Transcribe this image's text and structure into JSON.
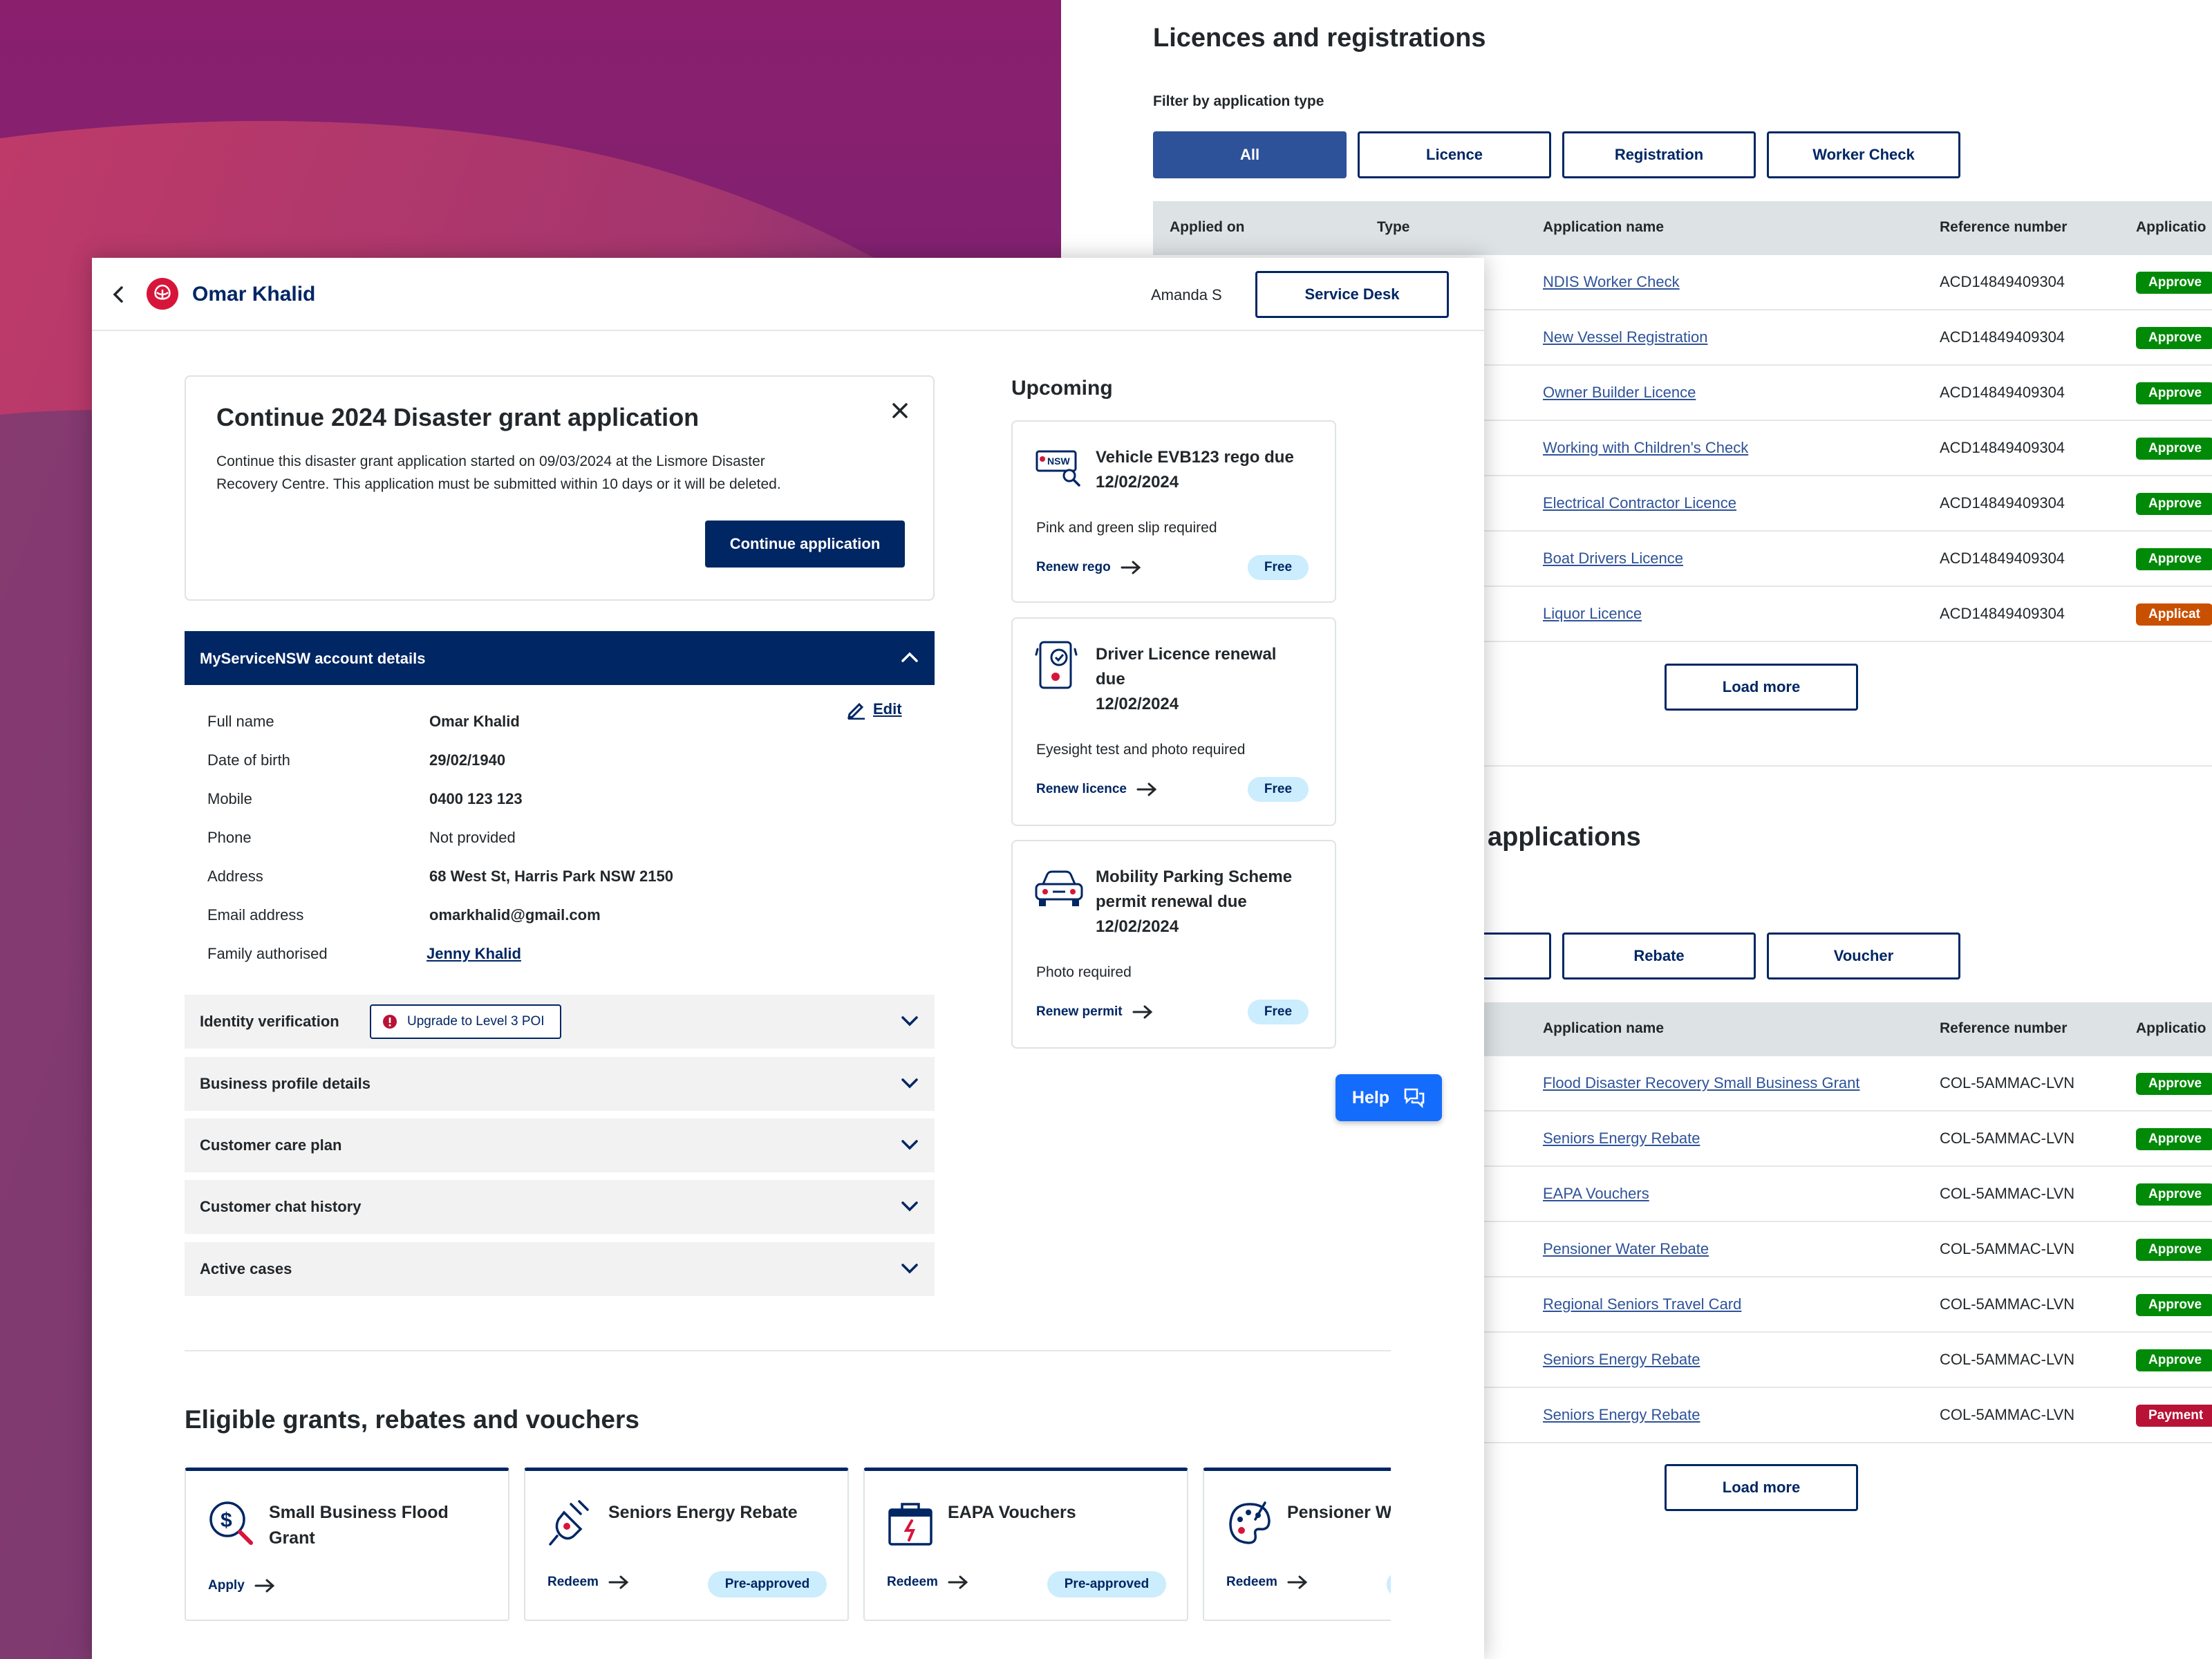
{
  "colors": {
    "navy": "#002664",
    "link": "#2e5299",
    "approved": "#008a07",
    "applicant": "#c95000",
    "payment": "#b81237",
    "help": "#146cfd",
    "badge_bg": "#cbedfd"
  },
  "licences": {
    "title": "Licences and registrations",
    "filter_label": "Filter by application type",
    "filters": [
      "All",
      "Licence",
      "Registration",
      "Worker Check"
    ],
    "columns": [
      "Applied on",
      "Type",
      "Application name",
      "Reference number",
      "Applicatio"
    ],
    "rows": [
      {
        "name": "NDIS Worker Check",
        "ref": "ACD14849409304",
        "status": "Approve",
        "tone": "green"
      },
      {
        "name": "New Vessel Registration",
        "ref": "ACD14849409304",
        "status": "Approve",
        "tone": "green"
      },
      {
        "name": "Owner Builder Licence",
        "ref": "ACD14849409304",
        "status": "Approve",
        "tone": "green"
      },
      {
        "name": "Working with Children's Check",
        "ref": "ACD14849409304",
        "status": "Approve",
        "tone": "green"
      },
      {
        "name": "Electrical Contractor Licence",
        "ref": "ACD14849409304",
        "status": "Approve",
        "tone": "green"
      },
      {
        "name": "Boat Drivers Licence",
        "ref": "ACD14849409304",
        "status": "Approve",
        "tone": "green"
      },
      {
        "name": "Liquor Licence",
        "ref": "ACD14849409304",
        "status": "Applicat",
        "tone": "orange"
      }
    ],
    "load_more": "Load more"
  },
  "applications": {
    "title": "applications",
    "filters": [
      "Rebate",
      "Voucher"
    ],
    "columns": [
      "Application name",
      "Reference number",
      "Applicatio"
    ],
    "rows": [
      {
        "name": "Flood Disaster Recovery Small Business Grant",
        "ref": "COL-5AMMAC-LVN",
        "status": "Approve",
        "tone": "green"
      },
      {
        "name": "Seniors Energy Rebate",
        "ref": "COL-5AMMAC-LVN",
        "status": "Approve",
        "tone": "green"
      },
      {
        "name": "EAPA Vouchers",
        "ref": "COL-5AMMAC-LVN",
        "status": "Approve",
        "tone": "green"
      },
      {
        "name": "Pensioner Water Rebate",
        "ref": "COL-5AMMAC-LVN",
        "status": "Approve",
        "tone": "green"
      },
      {
        "name": "Regional Seniors Travel Card",
        "ref": "COL-5AMMAC-LVN",
        "status": "Approve",
        "tone": "green"
      },
      {
        "name": "Seniors Energy Rebate",
        "ref": "COL-5AMMAC-LVN",
        "status": "Approve",
        "tone": "green"
      },
      {
        "name": "Seniors Energy Rebate",
        "ref": "COL-5AMMAC-LVN",
        "status": "Payment",
        "tone": "red"
      }
    ],
    "load_more": "Load more"
  },
  "header": {
    "customer_name": "Omar Khalid",
    "agent": "Amanda S",
    "service_desk": "Service Desk"
  },
  "continue_card": {
    "title": "Continue 2024 Disaster grant application",
    "body_line1": "Continue this disaster grant application started on 09/03/2024 at the Lismore Disaster",
    "body_line2": "Recovery Centre. This application must be submitted within 10 days or it will be deleted.",
    "button": "Continue application"
  },
  "account": {
    "title": "MyServiceNSW account details",
    "edit": "Edit",
    "fields": [
      {
        "label": "Full name",
        "value": "Omar Khalid"
      },
      {
        "label": "Date of birth",
        "value": "29/02/1940"
      },
      {
        "label": "Mobile",
        "value": "0400 123 123"
      },
      {
        "label": "Phone",
        "value": "Not provided"
      },
      {
        "label": "Address",
        "value": "68 West St, Harris Park NSW 2150"
      },
      {
        "label": "Email address",
        "value": "omarkhalid@gmail.com"
      },
      {
        "label": "Family authorised",
        "value": "Jenny Khalid"
      }
    ]
  },
  "sections": {
    "identity": "Identity verification",
    "identity_badge": "Upgrade to Level 3 POI",
    "business": "Business profile details",
    "care_plan": "Customer care plan",
    "chat_history": "Customer chat history",
    "active_cases": "Active cases"
  },
  "upcoming": {
    "title": "Upcoming",
    "items": [
      {
        "title_l1": "Vehicle EVB123 rego due",
        "title_l2": "12/02/2024",
        "title_l3": "",
        "desc": "Pink and green slip required",
        "link": "Renew rego",
        "badge": "Free",
        "icon": "nsw-plate-icon",
        "plate": "NSW"
      },
      {
        "title_l1": "Driver Licence renewal",
        "title_l2": "due",
        "title_l3": "12/02/2024",
        "desc": "Eyesight test and photo required",
        "link": "Renew licence",
        "badge": "Free",
        "icon": "licence-card-icon"
      },
      {
        "title_l1": "Mobility Parking Scheme",
        "title_l2": "permit renewal due",
        "title_l3": "12/02/2024",
        "desc": "Photo required",
        "link": "Renew permit",
        "badge": "Free",
        "icon": "car-icon"
      }
    ]
  },
  "help": {
    "label": "Help"
  },
  "grants": {
    "title": "Eligible grants, rebates and vouchers",
    "items": [
      {
        "title_l1": "Small Business Flood",
        "title_l2": "Grant",
        "link": "Apply",
        "badge": "",
        "icon": "dollar-search-icon"
      },
      {
        "title_l1": "Seniors Energy Rebate",
        "title_l2": "",
        "link": "Redeem",
        "badge": "Pre-approved",
        "icon": "plug-icon"
      },
      {
        "title_l1": "EAPA Vouchers",
        "title_l2": "",
        "link": "Redeem",
        "badge": "Pre-approved",
        "icon": "battery-icon"
      },
      {
        "title_l1": "Pensioner W",
        "title_l2": "",
        "link": "Redeem",
        "badge": "",
        "icon": "palette-icon"
      }
    ]
  }
}
